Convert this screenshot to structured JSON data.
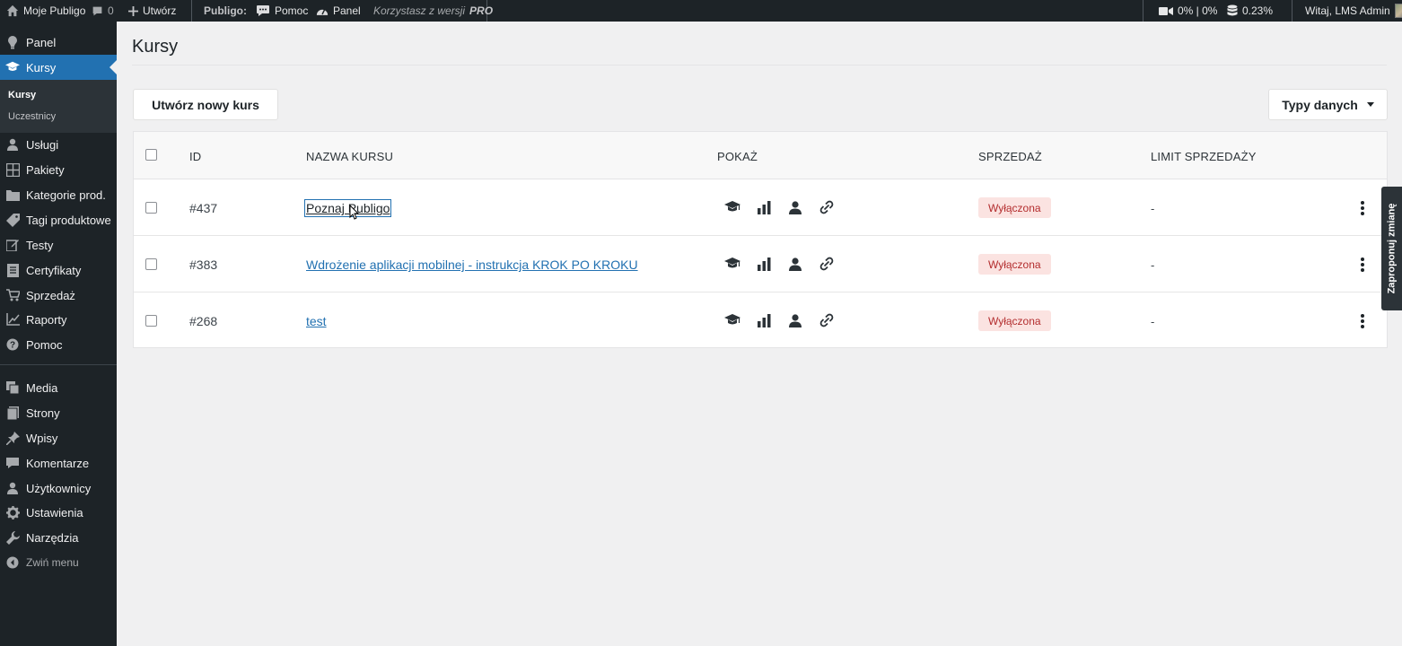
{
  "adminbar": {
    "site_name": "Moje Publigo",
    "comments_count": "0",
    "new_label": "Utwórz",
    "publigo_label": "Publigo:",
    "help_label": "Pomoc",
    "panel_label": "Panel",
    "version_prefix": "Korzystasz z wersji",
    "version_name": "PRO",
    "video_stats": "0% | 0%",
    "db_stats": "0.23%",
    "greeting": "Witaj, LMS Admin"
  },
  "sidebar": {
    "items": [
      {
        "label": "Panel",
        "icon": "gauge-icon"
      },
      {
        "label": "Kursy",
        "icon": "graduation-cap-icon"
      },
      {
        "label": "Usługi",
        "icon": "person-icon"
      },
      {
        "label": "Pakiety",
        "icon": "grid-icon"
      },
      {
        "label": "Kategorie prod.",
        "icon": "folder-icon"
      },
      {
        "label": "Tagi produktowe",
        "icon": "tag-icon"
      },
      {
        "label": "Testy",
        "icon": "edit-icon"
      },
      {
        "label": "Certyfikaty",
        "icon": "document-icon"
      },
      {
        "label": "Sprzedaż",
        "icon": "cart-icon"
      },
      {
        "label": "Raporty",
        "icon": "chart-line-icon"
      },
      {
        "label": "Pomoc",
        "icon": "help-icon"
      },
      {
        "label": "Media",
        "icon": "media-icon"
      },
      {
        "label": "Strony",
        "icon": "pages-icon"
      },
      {
        "label": "Wpisy",
        "icon": "pin-icon"
      },
      {
        "label": "Komentarze",
        "icon": "comment-icon"
      },
      {
        "label": "Użytkownicy",
        "icon": "users-icon"
      },
      {
        "label": "Ustawienia",
        "icon": "settings-icon"
      },
      {
        "label": "Narzędzia",
        "icon": "wrench-icon"
      },
      {
        "label": "Zwiń menu",
        "icon": "collapse-icon"
      }
    ],
    "submenu": [
      "Kursy",
      "Uczestnicy"
    ]
  },
  "main": {
    "title": "Kursy",
    "new_course_button": "Utwórz nowy kurs",
    "data_types_button": "Typy danych",
    "columns": [
      "ID",
      "NAZWA KURSU",
      "POKAŻ",
      "SPRZEDAŻ",
      "LIMIT SPRZEDAŻY"
    ],
    "rows": [
      {
        "id": "#437",
        "name": "Poznaj Publigo",
        "sales": "Wyłączona",
        "limit": "-"
      },
      {
        "id": "#383",
        "name": "Wdrożenie aplikacji mobilnej - instrukcja KROK PO KROKU",
        "sales": "Wyłączona",
        "limit": "-"
      },
      {
        "id": "#268",
        "name": "test",
        "sales": "Wyłączona",
        "limit": "-"
      }
    ],
    "row_icons": [
      "graduation-cap-icon",
      "bar-chart-icon",
      "person-icon",
      "link-icon"
    ]
  },
  "side_tab": "Zaproponuj zmianę",
  "colors": {
    "admin_dark": "#1d2327",
    "accent_blue": "#2271b1",
    "badge_bg": "#fbe3e1",
    "badge_text": "#b32d2e"
  }
}
